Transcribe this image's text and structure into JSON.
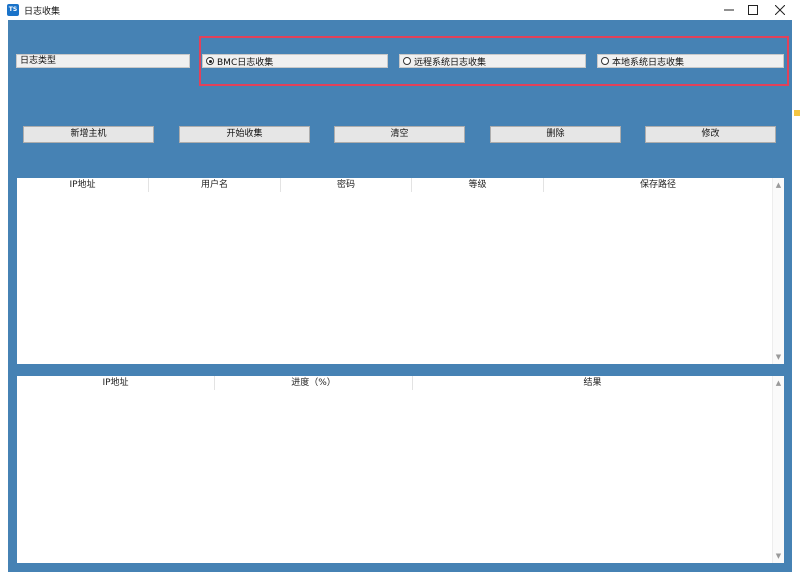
{
  "window": {
    "title": "日志收集",
    "icon_text": "TS"
  },
  "log_type": {
    "label": "日志类型",
    "options": [
      {
        "label": "BMC日志收集",
        "selected": true
      },
      {
        "label": "远程系统日志收集",
        "selected": false
      },
      {
        "label": "本地系统日志收集",
        "selected": false
      }
    ]
  },
  "toolbar": {
    "buttons": [
      "新增主机",
      "开始收集",
      "清空",
      "删除",
      "修改"
    ]
  },
  "host_table": {
    "columns": [
      "IP地址",
      "用户名",
      "密码",
      "等级",
      "保存路径"
    ]
  },
  "result_table": {
    "columns": [
      "IP地址",
      "进度（%）",
      "结果"
    ]
  },
  "colors": {
    "client_bg": "#4682b4",
    "highlight_border": "#e2415a"
  }
}
